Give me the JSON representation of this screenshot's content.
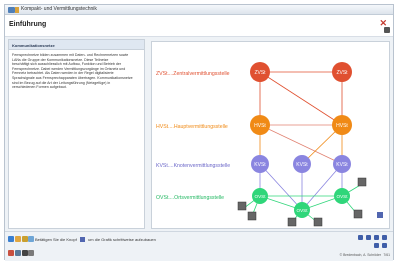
{
  "window": {
    "title": "Kompakt- und Vermittlungstechnik"
  },
  "header": {
    "title": "Einführung",
    "close_glyph": "✕"
  },
  "left_panel": {
    "heading": "Kommunikationsnetze",
    "body_lines": [
      "Fernsprechnetze bilden zusammen mit Daten- und Rechnernetzen sowie",
      "LANs die Gruppe der Kommunikationsnetze. Diese Teilnetze",
      "beschäftigt sich ausschliesslich mit Aufbau, Funktion und Betrieb der",
      "Fernsprechnetze. Dabei werden Vermittlungsvorgänge im Ortsnetz und",
      "Fernnetz betrachtet. Als Daten werden in der Regel digitalisierte",
      "Sprachsignale aus Fernsprechapparaten übertragen. Kommunikationsnetze",
      "sind im Bezug auf die Art der Leitungsführung (Netzgefüge) in",
      "verschiedenen Formen aufgebaut."
    ]
  },
  "diagram": {
    "levels": [
      {
        "label": "ZVSt....Zentralvermittlungsstelle",
        "color": "#e05030"
      },
      {
        "label": "HVSt....Hauptvermittlungsstelle",
        "color": "#f08a16"
      },
      {
        "label": "KVSt....Knotenvermittlungsstelle",
        "color": "#8a85e0"
      },
      {
        "label": "OVSt....Ortsvermittlungsstelle",
        "color": "#2fd67a"
      }
    ],
    "nodes": {
      "zvst_left": "ZVSt",
      "zvst_right": "ZVSt",
      "hvst_left": "HVSt",
      "hvst_right": "HVSt",
      "kvst_left": "KVSt",
      "kvst_mid": "KVSt",
      "kvst_right": "KVSt",
      "ovst_left": "OVSt",
      "ovst_mid": "OVSt",
      "ovst_right": "OVSt"
    }
  },
  "bottom": {
    "hint_before": "Betätigen Sie die Knopf",
    "hint_after": "um die Grafik schrittweise aufzubauen",
    "footer": "© Bredenbach, A. Schröder",
    "page": "7/61"
  }
}
